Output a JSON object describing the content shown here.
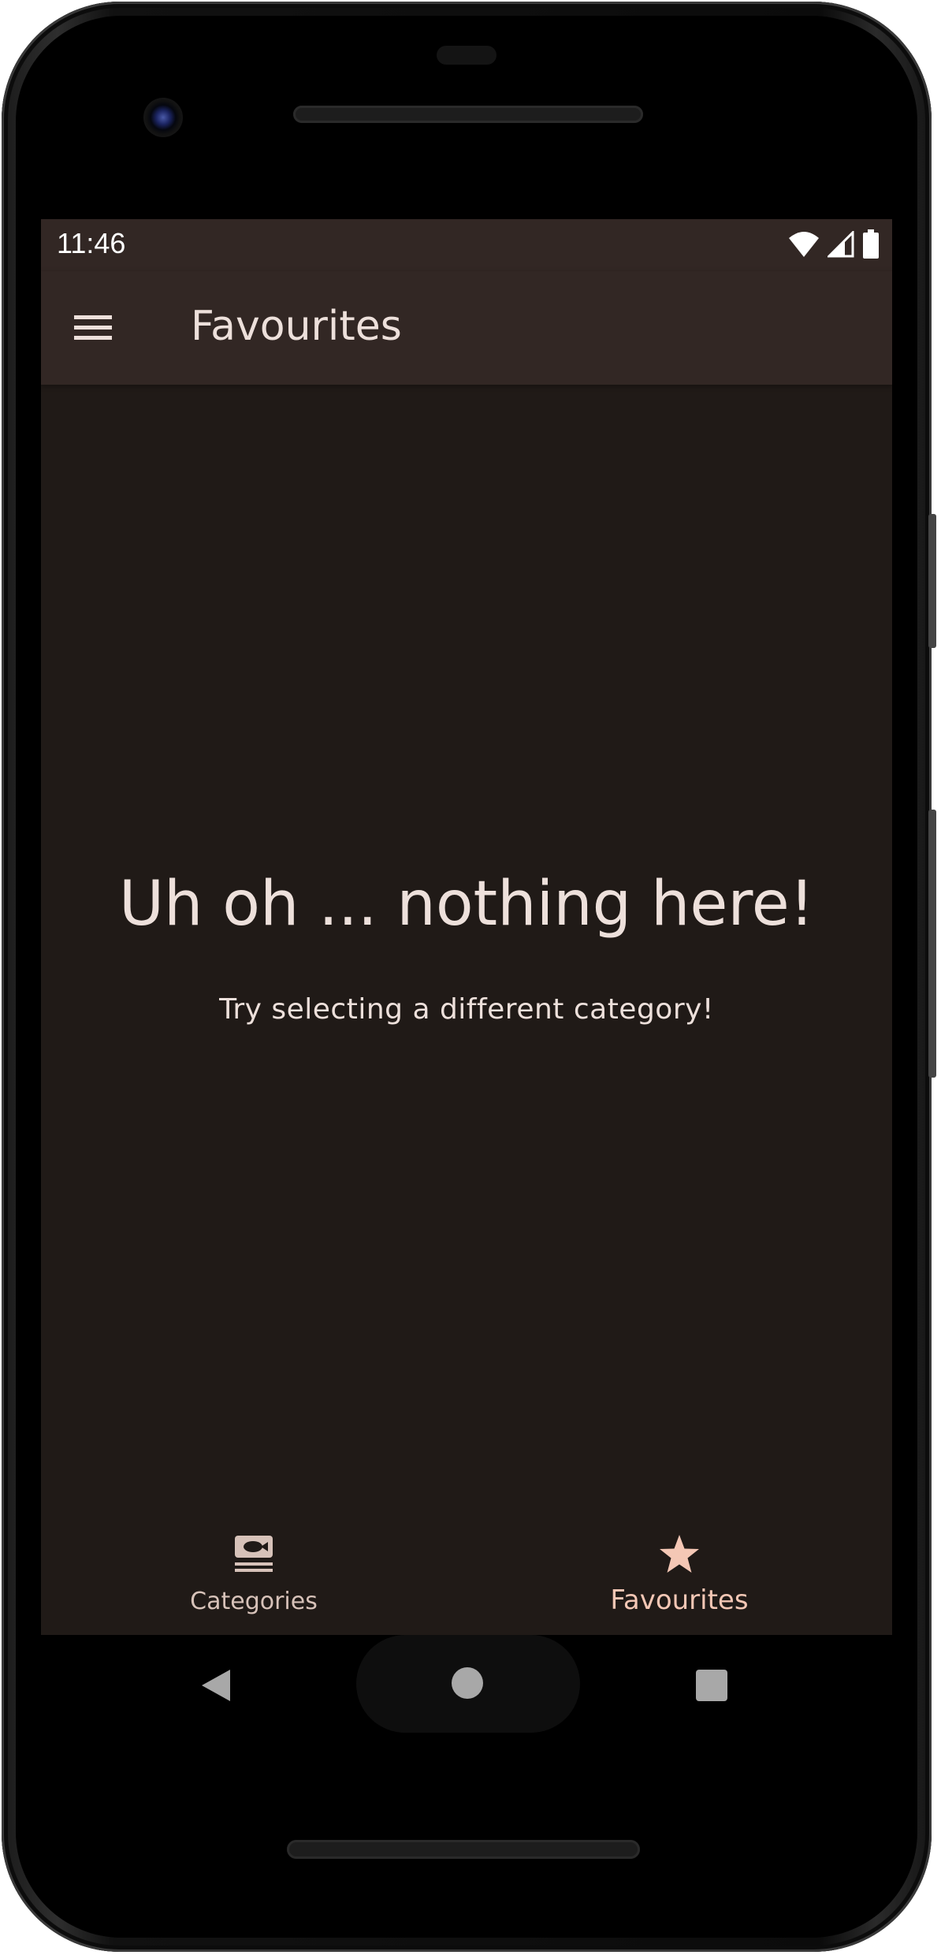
{
  "status_bar": {
    "time": "11:46",
    "icons": [
      "wifi-icon",
      "cellular-signal-icon",
      "battery-icon"
    ]
  },
  "app_bar": {
    "menu_icon": "hamburger-menu-icon",
    "title": "Favourites"
  },
  "empty_state": {
    "title": "Uh oh ... nothing here!",
    "subtitle": "Try selecting a different category!"
  },
  "bottom_nav": {
    "items": [
      {
        "label": "Categories",
        "icon": "set-meal-icon",
        "selected": false
      },
      {
        "label": "Favourites",
        "icon": "star-icon",
        "selected": true
      }
    ]
  },
  "system_nav": {
    "buttons": [
      "back-icon",
      "home-icon",
      "recents-icon"
    ]
  },
  "colors": {
    "screen_background": "#201a17",
    "app_bar_background": "#322724",
    "text_primary": "#ede0db",
    "accent": "#f4c7b5",
    "nav_unselected": "#d7c2b9"
  }
}
